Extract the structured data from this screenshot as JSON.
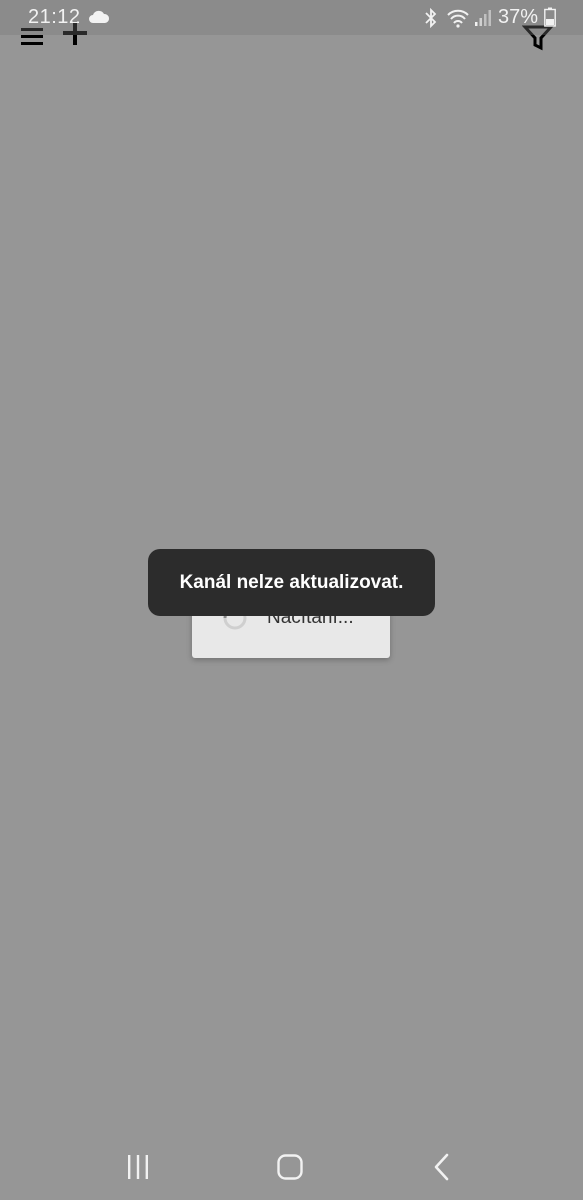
{
  "status_bar": {
    "time": "21:12",
    "battery": "37%",
    "icons": [
      "cloud-icon",
      "bluetooth-icon",
      "wifi-icon",
      "signal-icon",
      "battery-icon"
    ]
  },
  "app_toolbar": {
    "icons": [
      "menu-icon",
      "add-icon",
      "filter-icon"
    ]
  },
  "loading_dialog": {
    "text": "Načítání..."
  },
  "toast": {
    "message": "Kanál nelze aktualizovat."
  },
  "nav_bar": {
    "icons": [
      "recents-icon",
      "home-icon",
      "back-icon"
    ]
  },
  "colors": {
    "scrim": "#979797",
    "toast_bg": "#2c2c2c",
    "dialog_bg": "#e8e8e8"
  }
}
